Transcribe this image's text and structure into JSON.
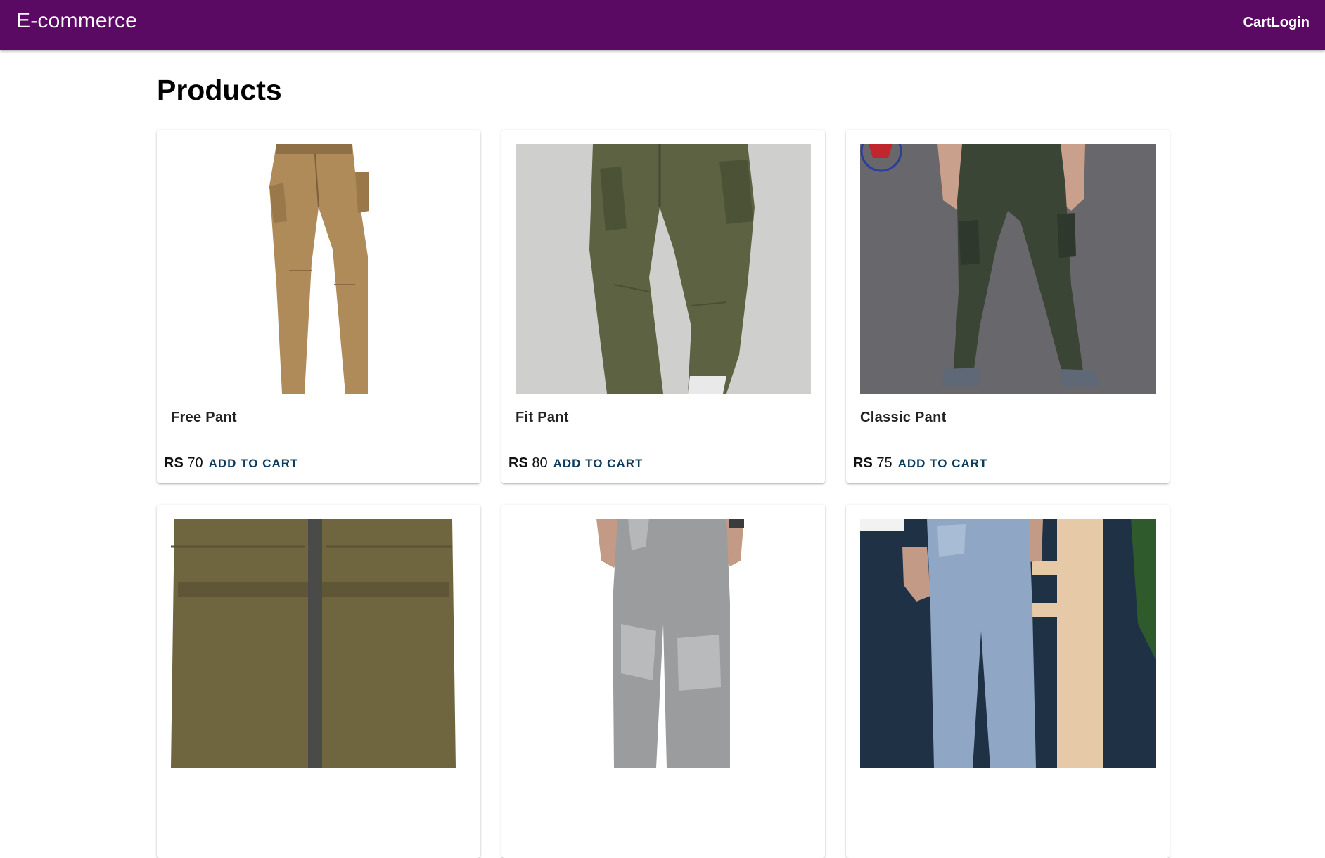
{
  "header": {
    "brand": "E-commerce",
    "cart_label": "Cart",
    "login_label": "Login"
  },
  "main": {
    "title": "Products"
  },
  "products": [
    {
      "name": "Free Pant",
      "currency": "RS",
      "price": "70",
      "action": "ADD TO CART"
    },
    {
      "name": "Fit Pant",
      "currency": "RS",
      "price": "80",
      "action": "ADD TO CART"
    },
    {
      "name": "Classic Pant",
      "currency": "RS",
      "price": "75",
      "action": "ADD TO CART"
    },
    {
      "name": "",
      "currency": "",
      "price": "",
      "action": ""
    },
    {
      "name": "",
      "currency": "",
      "price": "",
      "action": ""
    },
    {
      "name": "",
      "currency": "",
      "price": "",
      "action": ""
    }
  ],
  "colors": {
    "appbar": "#5a0a62",
    "action": "#0d3b5e"
  }
}
